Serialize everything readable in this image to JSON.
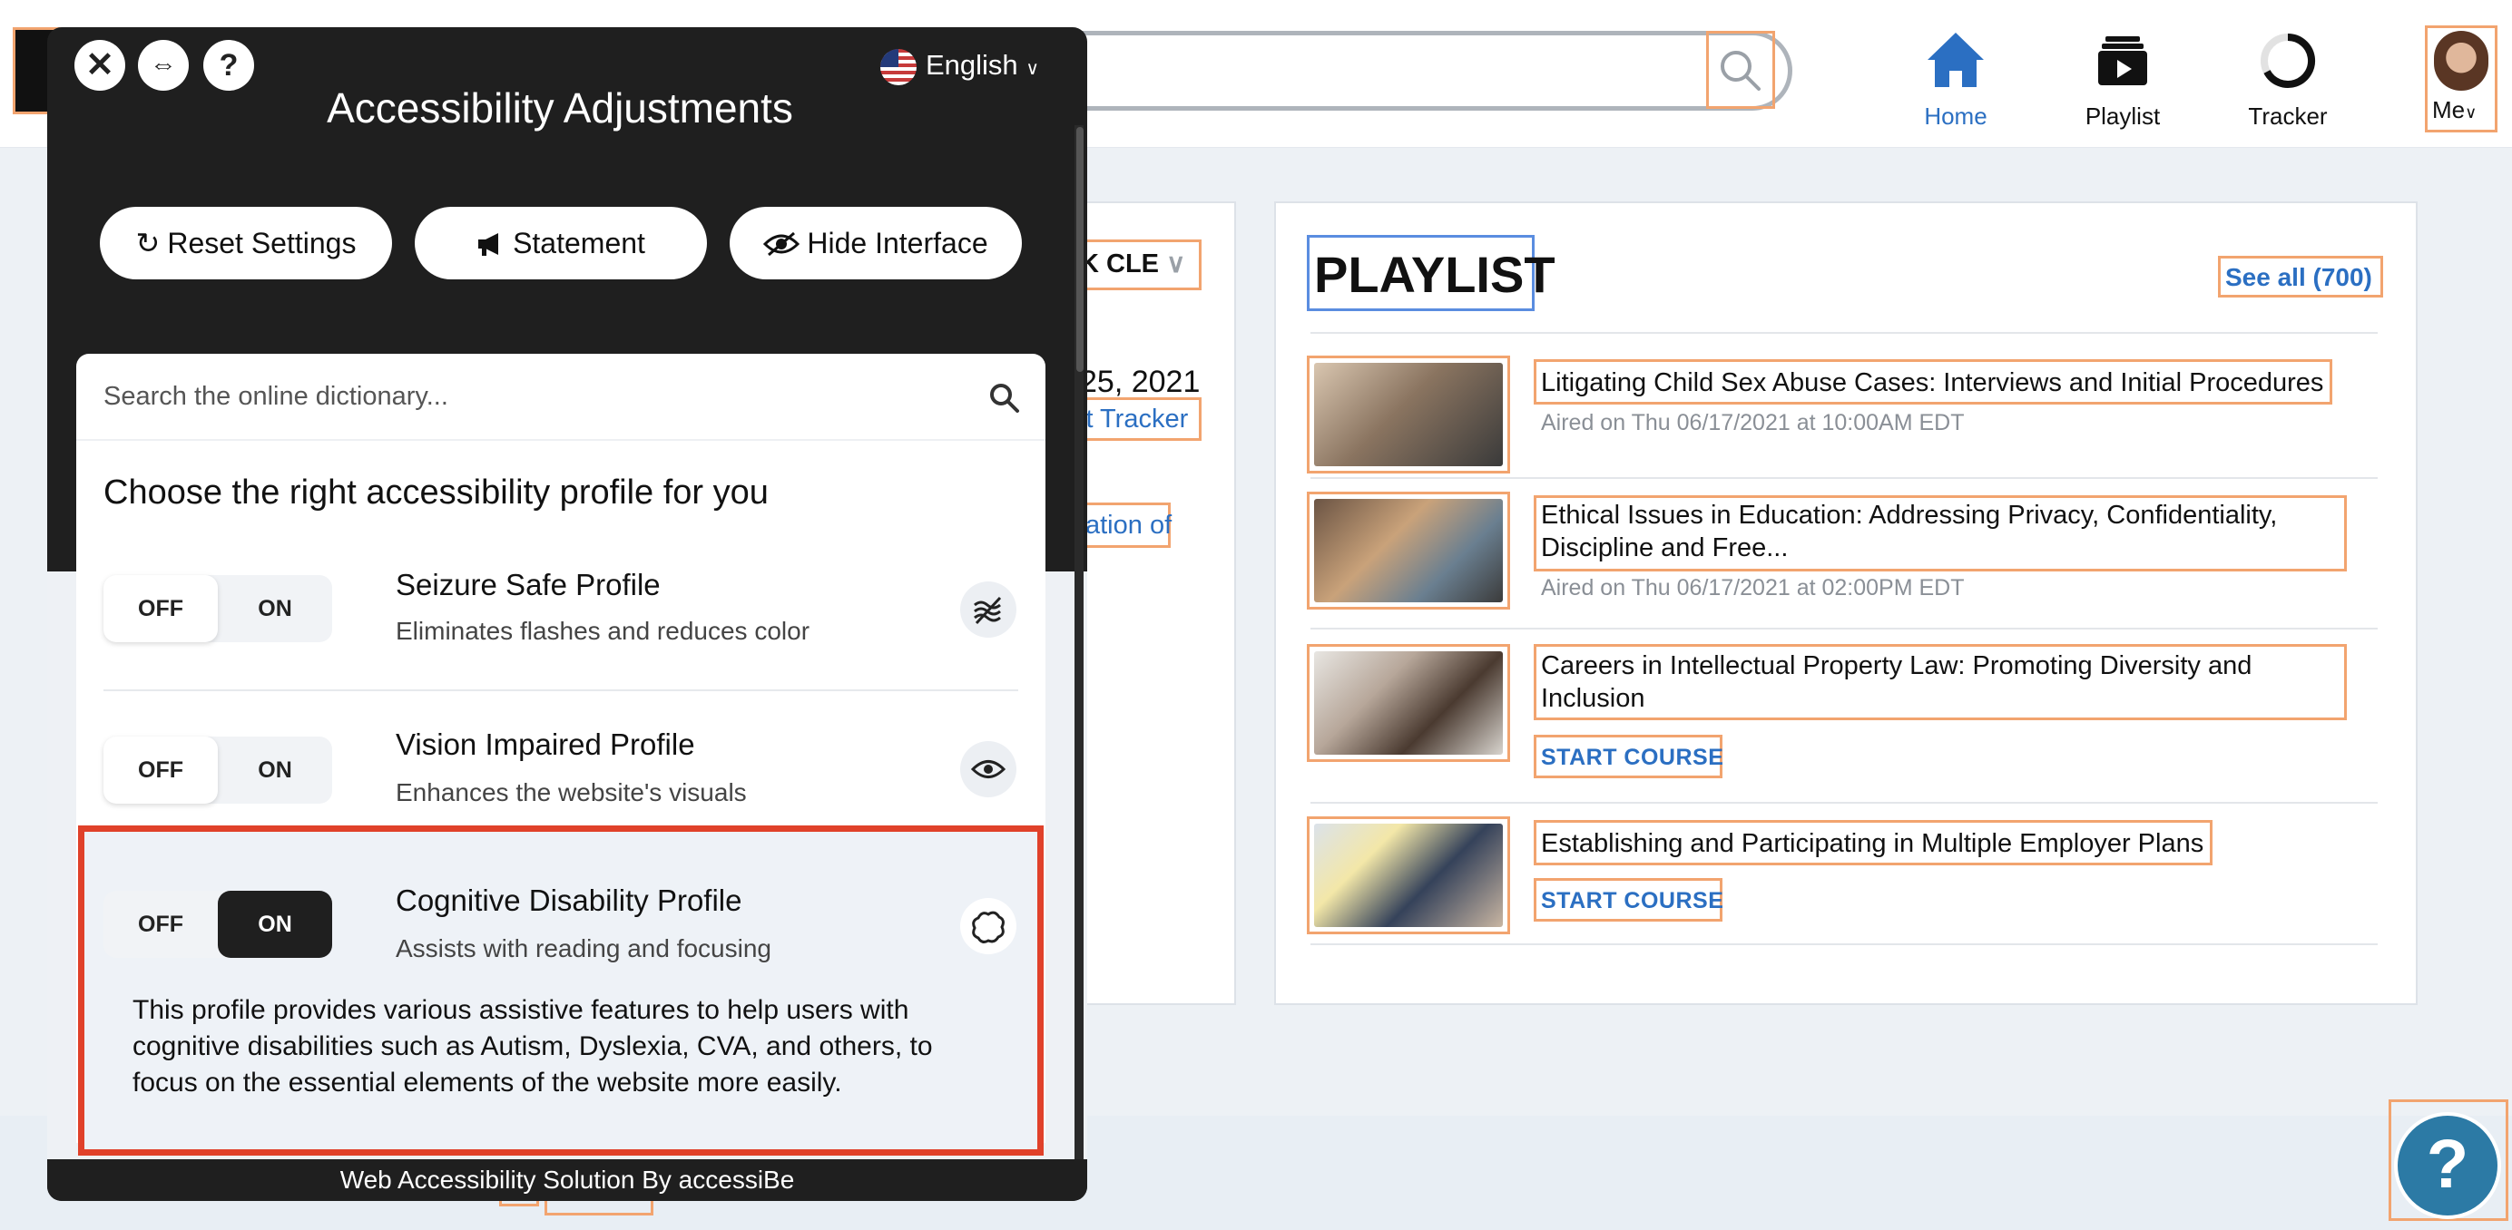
{
  "header": {
    "nav": [
      {
        "label": "Home",
        "icon": "home-icon"
      },
      {
        "label": "Playlist",
        "icon": "playlist-icon"
      },
      {
        "label": "Tracker",
        "icon": "tracker-icon"
      }
    ],
    "me_label": "Me",
    "accent_color": "#2b6fc2"
  },
  "left_card": {
    "dropdown_text": "K CLE",
    "date_text": "25, 2021",
    "tracker_link": "it Tracker",
    "cut_link": "ation of"
  },
  "playlist": {
    "title": "PLAYLIST",
    "see_all": "See all (700)",
    "items": [
      {
        "title": "Litigating Child Sex Abuse Cases: Interviews and Initial Procedures",
        "meta": "Aired on Thu 06/17/2021 at 10:00AM EDT"
      },
      {
        "title": "Ethical Issues in Education: Addressing Privacy, Confidentiality, Discipline and Free...",
        "meta": "Aired on Thu 06/17/2021 at 02:00PM EDT"
      },
      {
        "title": "Careers in Intellectual Property Law: Promoting Diversity and Inclusion",
        "action": "START COURSE"
      },
      {
        "title": "Establishing and Participating in Multiple Employer Plans",
        "action": "START COURSE"
      }
    ]
  },
  "help_button": "?",
  "accessibility": {
    "language": "English",
    "title": "Accessibility Adjustments",
    "buttons": {
      "reset": "Reset Settings",
      "statement": "Statement",
      "hide": "Hide Interface"
    },
    "search_placeholder": "Search the online dictionary...",
    "profiles_heading": "Choose the right accessibility profile for you",
    "toggle_off": "OFF",
    "toggle_on": "ON",
    "profiles": [
      {
        "name": "Seizure Safe Profile",
        "desc": "Eliminates flashes and reduces color",
        "state": "off",
        "icon": "seizure-icon"
      },
      {
        "name": "Vision Impaired Profile",
        "desc": "Enhances the website's visuals",
        "state": "off",
        "icon": "eye-icon"
      },
      {
        "name": "Cognitive Disability Profile",
        "desc": "Assists with reading and focusing",
        "state": "on",
        "icon": "brain-icon",
        "details": "This profile provides various assistive features to help users with cognitive disabilities such as Autism, Dyslexia, CVA, and others, to focus on the essential elements of the website more easily."
      }
    ],
    "footer": "Web Accessibility Solution By accessiBe",
    "highlight_color": "#e0412a"
  }
}
